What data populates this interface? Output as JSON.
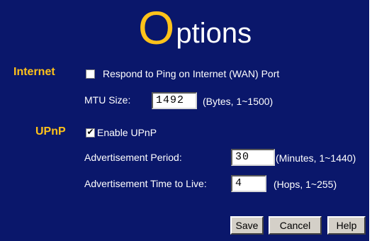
{
  "page": {
    "title_first_letter": "O",
    "title_rest": "ptions"
  },
  "internet": {
    "section_label": "Internet",
    "ping_label": "Respond to Ping on Internet (WAN) Port",
    "ping_checked": false,
    "mtu_label": "MTU Size:",
    "mtu_value": "1492",
    "mtu_hint": "(Bytes, 1~1500)"
  },
  "upnp": {
    "section_label": "UPnP",
    "enable_label": "Enable UPnP",
    "enable_checked": true,
    "adv_period_label": "Advertisement Period:",
    "adv_period_value": "30",
    "adv_period_hint": "(Minutes, 1~1440)",
    "adv_ttl_label": "Advertisement Time to Live:",
    "adv_ttl_value": "4",
    "adv_ttl_hint": "(Hops, 1~255)"
  },
  "buttons": {
    "save": "Save",
    "cancel": "Cancel",
    "help": "Help"
  },
  "colors": {
    "background": "#0a176b",
    "accent": "#ffc21a",
    "text": "#ffffff"
  }
}
